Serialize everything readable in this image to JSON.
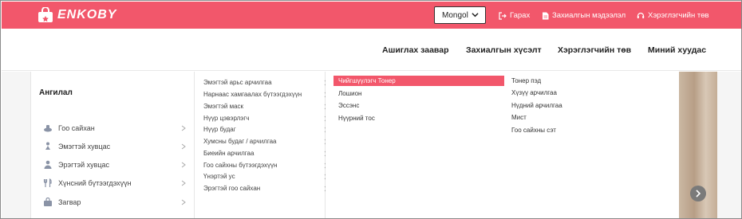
{
  "header": {
    "brand": "ENKOBY",
    "language": "Mongol",
    "links": [
      {
        "label": "Гарах",
        "icon": "logout-icon"
      },
      {
        "label": "Захиалгын мэдээлэл",
        "icon": "document-icon"
      },
      {
        "label": "Хэрэглэгчийн төв",
        "icon": "headset-icon"
      }
    ],
    "brand_color": "#f2576b"
  },
  "nav": {
    "items": [
      "Ашиглах заавар",
      "Захиалгын хүсэлт",
      "Хэрэглэгчийн төв",
      "Миний хуудас"
    ]
  },
  "categories": {
    "title": "Ангилал",
    "items": [
      {
        "label": "Гоо сайхан",
        "icon": "cosmetics-icon"
      },
      {
        "label": "Эмэгтэй хувцас",
        "icon": "woman-icon"
      },
      {
        "label": "Эрэгтэй хувцас",
        "icon": "man-icon"
      },
      {
        "label": "Хүнсний бүтээгдэхүүн",
        "icon": "cutlery-icon"
      },
      {
        "label": "Загвар",
        "icon": "bag-icon"
      }
    ]
  },
  "subcategories": [
    "Эмэгтэй арьс арчилгаа",
    "Нарнаас хамгаалах бүтээгдэхүүн",
    "Эмэгтэй маск",
    "Нүүр цэвэрлэгч",
    "Нүүр будаг",
    "Хумсны будаг / арчилгаа",
    "Биеийн арчилгаа",
    "Гоо сайхны бүтээгдэхүүн",
    "Үнэртэй ус",
    "Эрэгтэй гоо сайхан"
  ],
  "column3": {
    "active": "Чийгшүүлэгч Тонер",
    "items": [
      "Лошион",
      "Эссэнс",
      "Нүүрний тос"
    ]
  },
  "column4": {
    "items": [
      "Тонер пэд",
      "Хүзүү арчилгаа",
      "Нүдний арчилгаа",
      "Мист",
      "Гоо сайхны сэт"
    ]
  }
}
